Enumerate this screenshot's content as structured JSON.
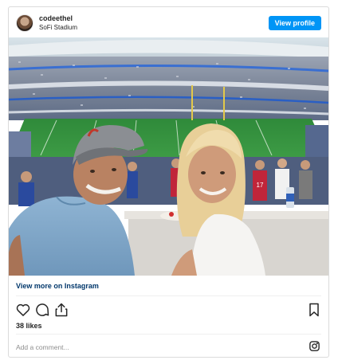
{
  "post": {
    "username": "codeethel",
    "location": "SoFi Stadium",
    "view_profile_label": "View profile",
    "view_more_label": "View more on Instagram",
    "likes": "38 likes",
    "comment_placeholder": "Add a comment...",
    "jersey_number": "17"
  },
  "icons": {
    "like": "heart-icon",
    "comment": "comment-icon",
    "share": "share-icon",
    "save": "bookmark-icon",
    "brand": "instagram-icon"
  },
  "colors": {
    "accent": "#0095f6",
    "link": "#00376b",
    "text": "#262626",
    "muted": "#8e8e8e",
    "border": "#dbdbdb"
  }
}
